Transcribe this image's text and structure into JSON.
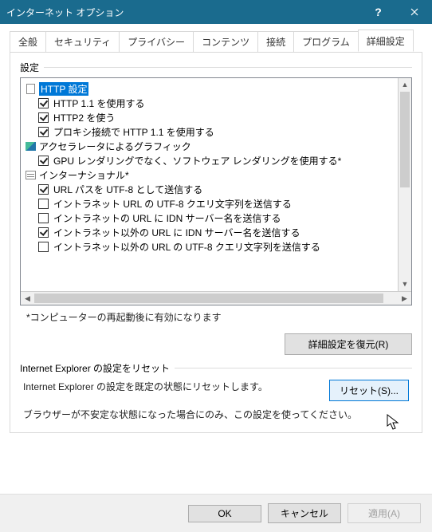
{
  "window": {
    "title": "インターネット オプション"
  },
  "tabs": [
    "全般",
    "セキュリティ",
    "プライバシー",
    "コンテンツ",
    "接続",
    "プログラム",
    "詳細設定"
  ],
  "active_tab_index": 6,
  "settings": {
    "legend": "設定",
    "groups": [
      {
        "icon": "doc",
        "label": "HTTP 設定",
        "selected": true,
        "items": [
          {
            "checked": true,
            "label": "HTTP 1.1 を使用する"
          },
          {
            "checked": true,
            "label": "HTTP2 を使う"
          },
          {
            "checked": true,
            "label": "プロキシ接続で HTTP 1.1 を使用する"
          }
        ]
      },
      {
        "icon": "accel",
        "label": "アクセラレータによるグラフィック",
        "items": [
          {
            "checked": true,
            "label": "GPU レンダリングでなく、ソフトウェア レンダリングを使用する*"
          }
        ]
      },
      {
        "icon": "intl",
        "label": "インターナショナル*",
        "items": [
          {
            "checked": true,
            "label": "URL パスを UTF-8 として送信する"
          },
          {
            "checked": false,
            "label": "イントラネット URL の UTF-8 クエリ文字列を送信する"
          },
          {
            "checked": false,
            "label": "イントラネットの URL に IDN サーバー名を送信する"
          },
          {
            "checked": true,
            "label": "イントラネット以外の URL に IDN サーバー名を送信する"
          },
          {
            "checked": false,
            "label": "イントラネット以外の URL の UTF-8 クエリ文字列を送信する"
          }
        ]
      }
    ],
    "note": "*コンピューターの再起動後に有効になります",
    "restore_button": "詳細設定を復元(R)"
  },
  "reset": {
    "legend": "Internet Explorer の設定をリセット",
    "text": "Internet Explorer の設定を既定の状態にリセットします。",
    "button": "リセット(S)...",
    "warning": "ブラウザーが不安定な状態になった場合にのみ、この設定を使ってください。"
  },
  "footer": {
    "ok": "OK",
    "cancel": "キャンセル",
    "apply": "適用(A)"
  }
}
